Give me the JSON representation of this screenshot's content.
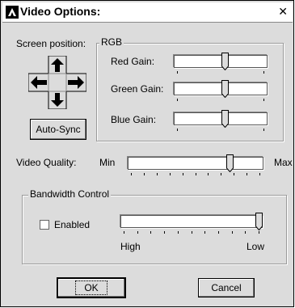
{
  "window": {
    "title": "Video Options:",
    "close_glyph": "✕"
  },
  "screen_position": {
    "label": "Screen position:",
    "arrows": [
      "up-arrow-icon",
      "left-arrow-icon",
      "right-arrow-icon",
      "down-arrow-icon"
    ],
    "auto_sync_label": "Auto-Sync"
  },
  "rgb": {
    "group_label": "RGB",
    "red": {
      "label": "Red Gain:",
      "value": 0.55
    },
    "green": {
      "label": "Green Gain:",
      "value": 0.55
    },
    "blue": {
      "label": "Blue Gain:",
      "value": 0.55
    }
  },
  "video_quality": {
    "label": "Video Quality:",
    "min_label": "Min",
    "max_label": "Max",
    "value": 0.77
  },
  "bandwidth": {
    "group_label": "Bandwidth Control",
    "enabled_label": "Enabled",
    "enabled_checked": false,
    "high_label": "High",
    "low_label": "Low",
    "value": 1.0
  },
  "buttons": {
    "ok_label": "OK",
    "cancel_label": "Cancel"
  }
}
